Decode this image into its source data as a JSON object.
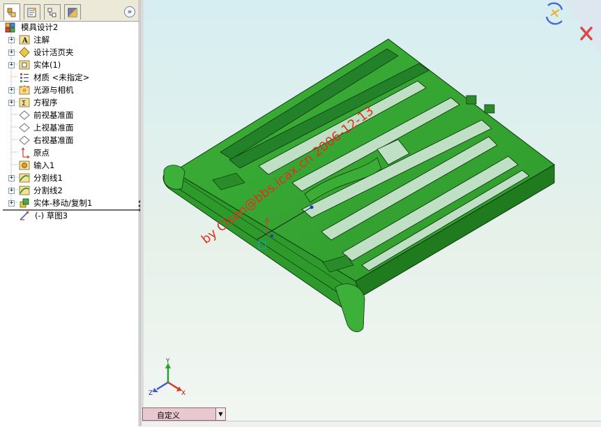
{
  "tabs": [
    {
      "name": "feature-manager",
      "icon": "feature-tree-icon"
    },
    {
      "name": "property-manager",
      "icon": "property-manager-icon"
    },
    {
      "name": "configuration-manager",
      "icon": "configuration-icon"
    },
    {
      "name": "display-manager",
      "icon": "display-manager-icon"
    }
  ],
  "expand_label": "»",
  "tree": {
    "root": {
      "label": "模具设计2",
      "icon": "part-icon"
    },
    "items": [
      {
        "label": "注解",
        "icon": "annotation-icon",
        "expandable": true
      },
      {
        "label": "设计活页夹",
        "icon": "design-binder-icon",
        "expandable": true
      },
      {
        "label": "实体(1)",
        "icon": "solid-bodies-icon",
        "expandable": true
      },
      {
        "label": "材质 <未指定>",
        "icon": "material-icon",
        "expandable": false
      },
      {
        "label": "光源与相机",
        "icon": "lights-cameras-icon",
        "expandable": true
      },
      {
        "label": "方程序",
        "icon": "equations-icon",
        "expandable": true
      },
      {
        "label": "前视基准面",
        "icon": "plane-icon",
        "expandable": false
      },
      {
        "label": "上视基准面",
        "icon": "plane-icon",
        "expandable": false
      },
      {
        "label": "右视基准面",
        "icon": "plane-icon",
        "expandable": false
      },
      {
        "label": "原点",
        "icon": "origin-icon",
        "expandable": false
      },
      {
        "label": "输入1",
        "icon": "imported-body-icon",
        "expandable": false
      },
      {
        "label": "分割线1",
        "icon": "split-line-icon",
        "expandable": true
      },
      {
        "label": "分割线2",
        "icon": "split-line-icon",
        "expandable": true
      },
      {
        "label": "实体-移动/复制1",
        "icon": "move-copy-body-icon",
        "expandable": true
      },
      {
        "label": "(-) 草图3",
        "icon": "sketch-icon",
        "expandable": false
      }
    ]
  },
  "viewport": {
    "watermark": "by Clsen@bbs.icax.cn 2006-12-13",
    "watermark_color": "#e03020",
    "model_color": "#36a333",
    "triad": {
      "x": "X",
      "y": "Y",
      "z": "Z"
    }
  },
  "confirm_corner": {
    "ok_icon": "rebuild-confirm-icon",
    "cancel_icon": "cancel-x-icon"
  },
  "view_orientation": {
    "selected": "自定义"
  }
}
